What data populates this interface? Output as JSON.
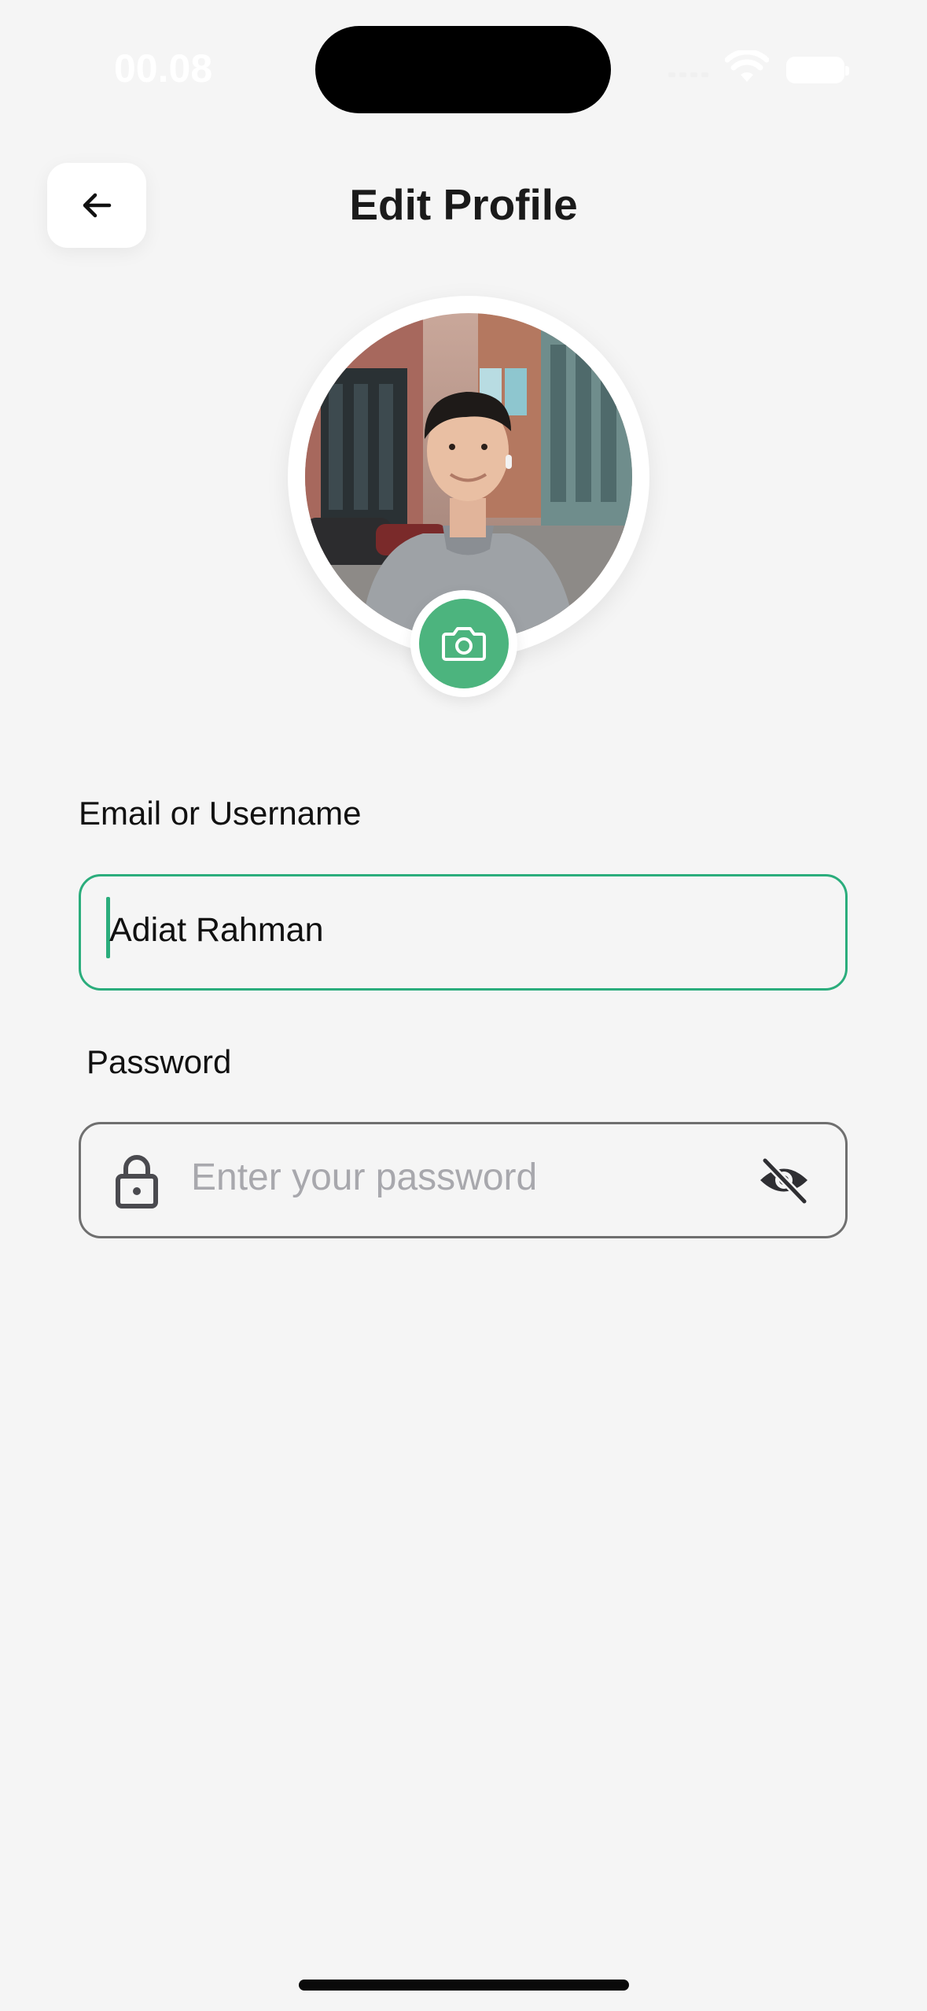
{
  "status_bar": {
    "time": "00.08"
  },
  "header": {
    "title": "Edit Profile",
    "back_icon": "arrow-left-icon"
  },
  "avatar": {
    "alt": "Profile photo",
    "camera_icon": "camera-icon",
    "accent_color": "#4cb47e"
  },
  "form": {
    "email": {
      "label": "Email or Username",
      "value": "Adiat Rahman",
      "border_color": "#2bad7c"
    },
    "password": {
      "label": "Password",
      "placeholder": "Enter your password",
      "leading_icon": "lock-icon",
      "trailing_icon": "eye-off-icon"
    }
  }
}
